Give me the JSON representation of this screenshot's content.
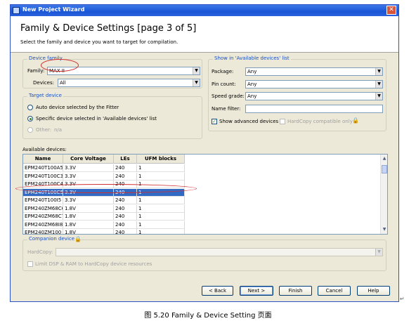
{
  "window": {
    "title": "New Project Wizard",
    "close_glyph": "✕"
  },
  "header": {
    "title": "Family & Device Settings [page 3 of 5]",
    "subtitle": "Select the family and device you want to target for compilation."
  },
  "device_family": {
    "group_label": "Device family",
    "family_label": "Family:",
    "family_value": "MAX II",
    "devices_label": "Devices:",
    "devices_value": "All"
  },
  "target_device": {
    "group_label": "Target device",
    "auto_label": "Auto device selected by the Fitter",
    "specific_label": "Specific device selected in 'Available devices' list",
    "other_label": "Other:",
    "other_value": "n/a",
    "selected_option": "specific"
  },
  "show_in": {
    "group_label": "Show in 'Available devices' list",
    "package_label": "Package:",
    "package_value": "Any",
    "pincount_label": "Pin count:",
    "pincount_value": "Any",
    "speed_label": "Speed grade:",
    "speed_value": "Any",
    "name_filter_label": "Name filter:",
    "name_filter_value": "",
    "show_advanced_label": "Show advanced devices",
    "show_advanced_checked": true,
    "hardcopy_compatible_label": "HardCopy compatible only",
    "hardcopy_compatible_checked": false
  },
  "available_devices": {
    "label": "Available devices:",
    "columns": [
      "Name",
      "Core Voltage",
      "LEs",
      "UFM blocks"
    ],
    "rows": [
      [
        "EPM240T100A5",
        "3.3V",
        "240",
        "1"
      ],
      [
        "EPM240T100C3",
        "3.3V",
        "240",
        "1"
      ],
      [
        "EPM240T100C4",
        "3.3V",
        "240",
        "1"
      ],
      [
        "EPM240T100C5",
        "3.3V",
        "240",
        "1"
      ],
      [
        "EPM240T100I5",
        "3.3V",
        "240",
        "1"
      ],
      [
        "EPM240ZM68C6",
        "1.8V",
        "240",
        "1"
      ],
      [
        "EPM240ZM68C7",
        "1.8V",
        "240",
        "1"
      ],
      [
        "EPM240ZM68I8",
        "1.8V",
        "240",
        "1"
      ],
      [
        "EPM240ZM100",
        "1.8V",
        "240",
        "1"
      ]
    ],
    "selected_row": 3
  },
  "companion": {
    "group_label": "Companion device",
    "hardcopy_label": "HardCopy:",
    "hardcopy_value": "",
    "limit_label": "Limit DSP & RAM to HardCopy device resources"
  },
  "buttons": {
    "back": "< Back",
    "next": "Next >",
    "finish": "Finish",
    "cancel": "Cancel",
    "help": "Help"
  },
  "caption": "图 5.20 Family & Device Setting 页面",
  "colors": {
    "selection": "#316ac5",
    "annotation": "#d03030",
    "titlebar": "#1a55d6",
    "group_label": "#1b50c0"
  }
}
